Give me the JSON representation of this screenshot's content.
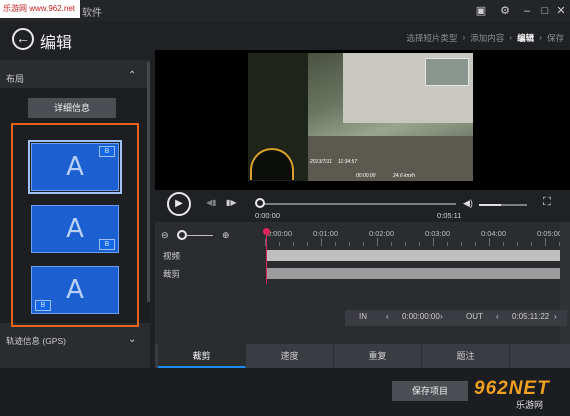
{
  "watermark": "乐游网 www.962.net",
  "app": {
    "title": "软件"
  },
  "window_buttons": [
    "toolbox-icon",
    "settings-icon",
    "minimize-icon",
    "maximize-icon",
    "close-icon"
  ],
  "header": {
    "page_title": "编辑",
    "steps": [
      "选择短片类型",
      "添加内容",
      "编辑",
      "保存"
    ],
    "active_step": 2
  },
  "left_panel": {
    "layout_label": "布局",
    "details_button": "详细信息",
    "thumbs": [
      {
        "main": "A",
        "badge": "B"
      },
      {
        "main": "A",
        "badge": "B"
      },
      {
        "main": "A",
        "badge": "B"
      }
    ],
    "gps_label": "轨迹信息 (GPS)"
  },
  "player": {
    "current_time": "0:00:00",
    "total_time": "0:05:11",
    "osd": {
      "date": "2013/7/11",
      "clock": "11:34:57",
      "speed": "24.6 km/h",
      "dist": "00:00:00"
    }
  },
  "timeline": {
    "ticks": [
      "0:00:00",
      "0:01:00",
      "0:02:00",
      "0:03:00",
      "0:04:00",
      "0:05:00"
    ],
    "track_video": "视频",
    "track_cut": "裁剪"
  },
  "inout": {
    "in_label": "IN",
    "in_time": "0:00:00:00",
    "out_label": "OUT",
    "out_time": "0:05:11:22"
  },
  "tabs": [
    "裁剪",
    "速度",
    "重复",
    "题注"
  ],
  "bottom": {
    "save_button": "保存项目",
    "brand_main": "962NET",
    "brand_sub": "乐游网"
  }
}
